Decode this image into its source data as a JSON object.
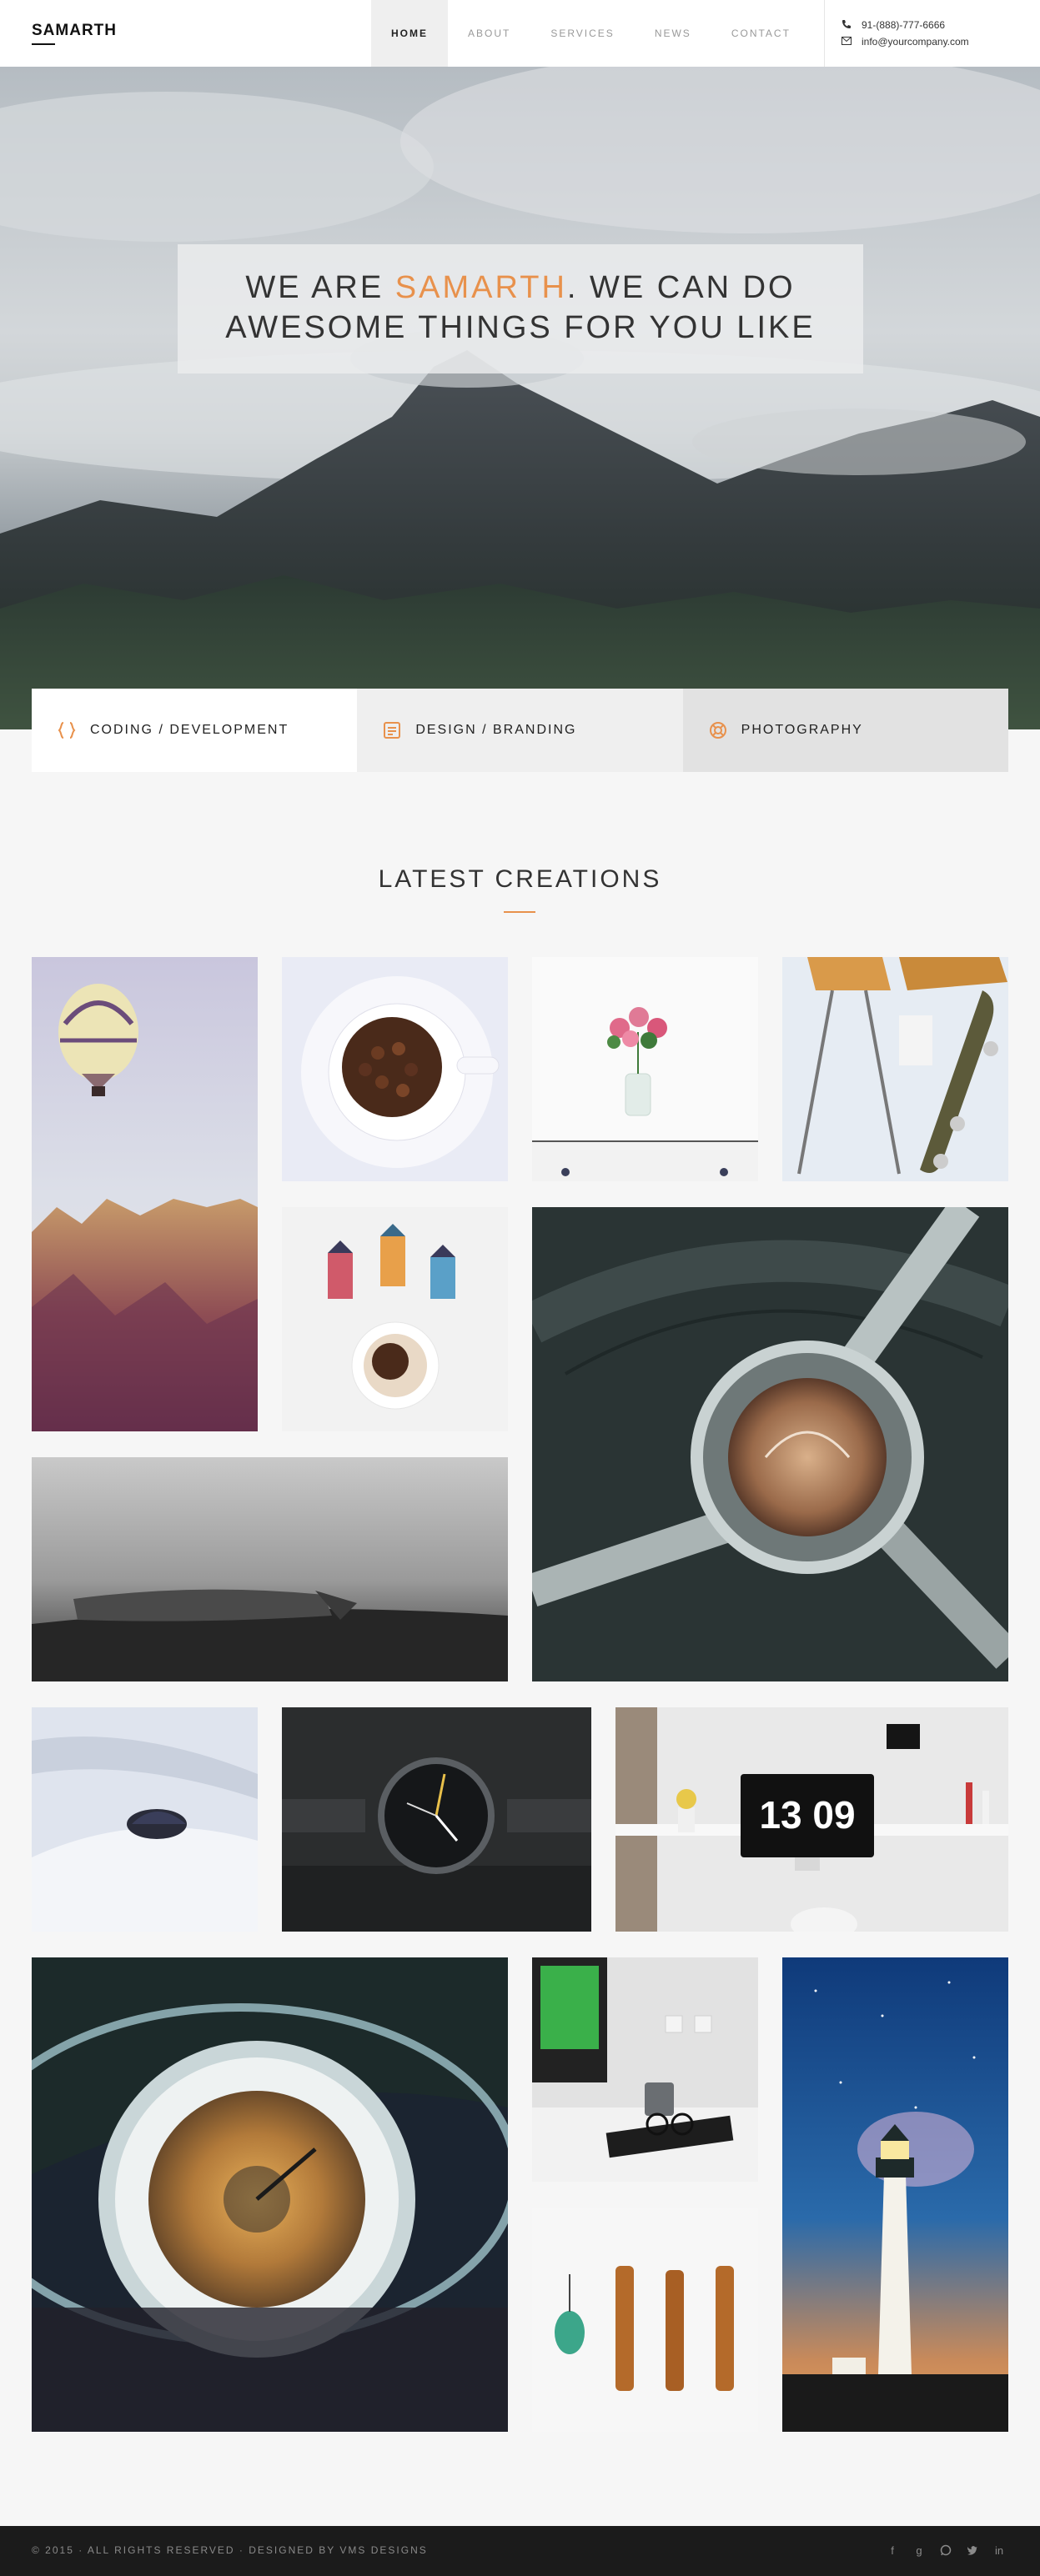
{
  "header": {
    "logo": "SAMARTH",
    "nav": [
      "HOME",
      "ABOUT",
      "SERVICES",
      "NEWS",
      "CONTACT"
    ],
    "active_nav": "HOME",
    "phone": "91-(888)-777-6666",
    "email": "info@yourcompany.com"
  },
  "hero": {
    "line1_before": "WE ARE ",
    "line1_accent": "SAMARTH",
    "line1_after": ". WE CAN DO",
    "line2": "AWESOME THINGS FOR YOU LIKE"
  },
  "services": [
    {
      "label": "CODING / DEVELOPMENT",
      "icon": "code-braces-icon"
    },
    {
      "label": "DESIGN / BRANDING",
      "icon": "layout-icon"
    },
    {
      "label": "PHOTOGRAPHY",
      "icon": "lifebuoy-icon"
    }
  ],
  "creations": {
    "title": "LATEST CREATIONS",
    "clock_text": "13 09"
  },
  "footer": {
    "copyright": "© 2015 · ALL RIGHTS RESERVED · DESIGNED BY VMS DESIGNS",
    "social": [
      "facebook-icon",
      "google-plus-icon",
      "whatsapp-icon",
      "twitter-icon",
      "linkedin-icon"
    ]
  },
  "colors": {
    "accent": "#e8914c",
    "footer_bg": "#1b1b1b"
  }
}
